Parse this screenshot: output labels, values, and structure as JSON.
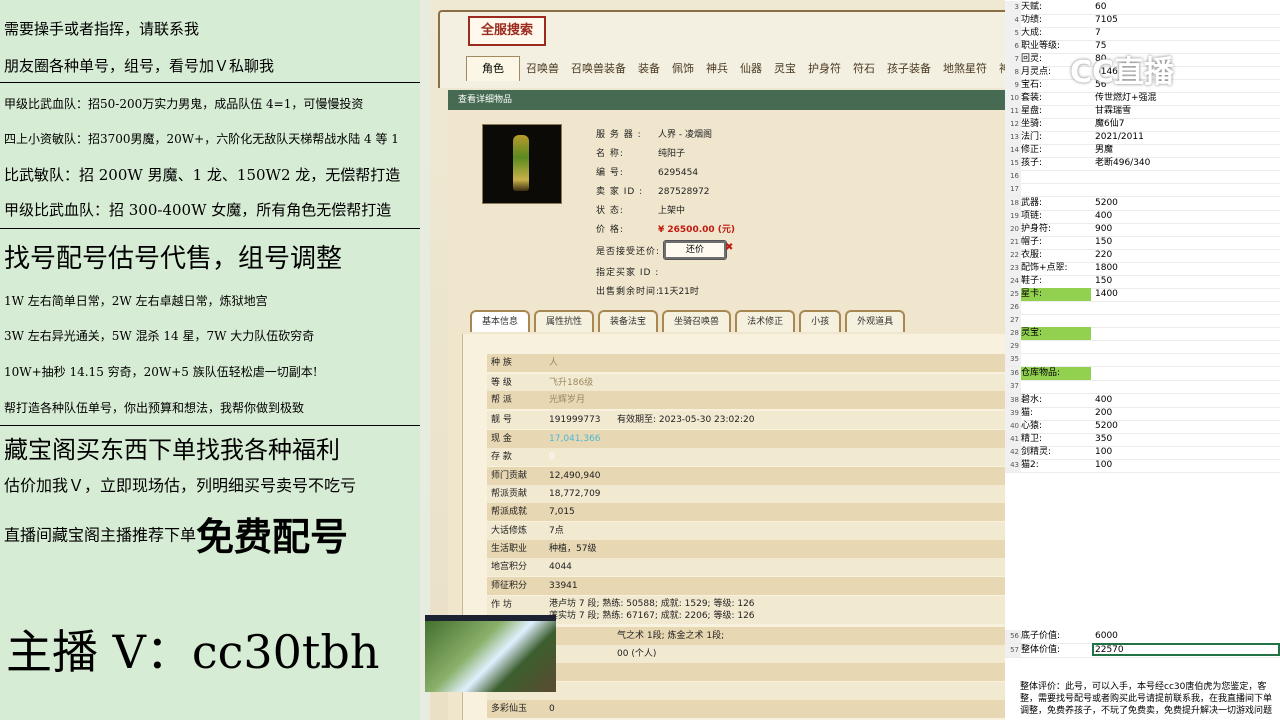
{
  "promo": {
    "line1": "需要操手或者指挥，请联系我",
    "line2": "朋友圈各种单号，组号，看号加Ｖ私聊我",
    "line3": "甲级比武血队：招50-200万实力男鬼，成品队伍 4=1，可慢慢投资",
    "line4": "四上小资敏队：招3700男魔，20W+，六阶化无敌队天梯帮战水陆 4 等 1",
    "line5": "比武敏队：招 200W 男魔、1 龙、150W2 龙，无偿帮打造",
    "line6": "甲级比武血队：招 300-400W 女魔，所有角色无偿帮打造",
    "line7": "找号配号估号代售，组号调整",
    "line8": "1W 左右简单日常，2W 左右卓越日常，炼狱地宫",
    "line9": "3W 左右异光通关，5W 混杀 14 星，7W 大力队伍砍穷奇",
    "line10": "10W+抽秒 14.15 穷奇，20W+5 族队伍轻松虐一切副本!",
    "line11": "帮打造各种队伍单号，你出预算和想法，我帮你做到极致",
    "line12": "藏宝阁买东西下单找我各种福利",
    "line13": "估价加我Ｖ，立即现场估，列明细买号卖号不吃亏",
    "line14a": "直播间藏宝阁主播推荐下单",
    "line14b": "免费配号",
    "streamer": "主播 V：cc30tbh"
  },
  "game": {
    "search_title": "全服搜索",
    "tabs": [
      "角色",
      "召唤兽",
      "召唤兽装备",
      "装备",
      "佩饰",
      "神兵",
      "仙器",
      "灵宝",
      "护身符",
      "符石",
      "孩子装备",
      "地煞星符",
      "神"
    ],
    "detail_bar": "查看详细物品",
    "info": {
      "server_k": "服 务 器 :",
      "server_v": "人界 - 凌烟阁",
      "name_k": "名        称:",
      "name_v": "纯阳子",
      "id_k": "编        号:",
      "id_v": "6295454",
      "seller_k": "卖 家 ID :",
      "seller_v": "287528972",
      "status_k": "状        态:",
      "status_v": "上架中",
      "price_k": "价        格:",
      "price_v": "¥ 26500.00 (元)",
      "haggle_k": "是否接受还价:",
      "haggle_btn": "还价",
      "buyer_k": "指定买家 ID :",
      "buyer_v": "",
      "remain_k": "出售剩余时间:",
      "remain_v": "11天21时"
    },
    "sections": [
      "基本信息",
      "属性抗性",
      "装备法宝",
      "坐骑召唤兽",
      "法术修正",
      "小孩",
      "外观道具"
    ],
    "rows": [
      {
        "k": "种    族",
        "v": "人"
      },
      {
        "k": "等    级",
        "v": "飞升186级"
      },
      {
        "k": "帮    派",
        "v": "光辉岁月"
      },
      {
        "k": "靓    号",
        "v": "191999773",
        "extra": "有效期至:  2023-05-30 23:02:20"
      },
      {
        "k": "现    金",
        "v": "17,041,366"
      },
      {
        "k": "存    款",
        "v": "0"
      },
      {
        "k": "师门贡献",
        "v": "12,490,940"
      },
      {
        "k": "帮派贡献",
        "v": "18,772,709"
      },
      {
        "k": "帮派成就",
        "v": "7,015"
      },
      {
        "k": "大话修炼",
        "v": "7点"
      },
      {
        "k": "生活职业",
        "v": "种植，57级"
      },
      {
        "k": "地宫积分",
        "v": "4044"
      },
      {
        "k": "师征积分",
        "v": "33941"
      },
      {
        "k": "作    坊",
        "v": "港卢坊 7 段; 熟练:  50588;  成就:  1529;  等级:  126",
        "v2": "莲实坊 7 段; 熟练:  67167;  成就:  2206;  等级:  126"
      },
      {
        "k": "",
        "v": "气之术 1段; 炼金之术 1段;"
      },
      {
        "k": "",
        "v": "00 (个人)"
      },
      {
        "k": "",
        "v": ""
      },
      {
        "k": "",
        "v": ""
      },
      {
        "k": "多彩仙玉",
        "v": "0"
      }
    ]
  },
  "sheet": {
    "logo": "CC直播",
    "rows": [
      {
        "n": "3",
        "k": "天赋:",
        "v": "60"
      },
      {
        "n": "4",
        "k": "功绩:",
        "v": "7105"
      },
      {
        "n": "5",
        "k": "大成:",
        "v": "7"
      },
      {
        "n": "6",
        "k": "职业等级:",
        "v": "75"
      },
      {
        "n": "7",
        "k": "回灵:",
        "v": "80"
      },
      {
        "n": "8",
        "k": "月灵点:",
        "v": "6146"
      },
      {
        "n": "9",
        "k": "宝石:",
        "v": "56"
      },
      {
        "n": "10",
        "k": "套装:",
        "v": "传世燃灯+强混"
      },
      {
        "n": "11",
        "k": "星盘:",
        "v": "甘霖瑞雪"
      },
      {
        "n": "12",
        "k": "坐骑:",
        "v": "魔6仙7"
      },
      {
        "n": "13",
        "k": "法门:",
        "v": "2021/2011"
      },
      {
        "n": "14",
        "k": "修正:",
        "v": "男魔"
      },
      {
        "n": "15",
        "k": "孩子:",
        "v": "老断496/340"
      },
      {
        "n": "16",
        "k": "",
        "v": ""
      },
      {
        "n": "17",
        "k": "",
        "v": ""
      },
      {
        "n": "18",
        "k": "武器:",
        "v": "5200"
      },
      {
        "n": "19",
        "k": "项链:",
        "v": "400"
      },
      {
        "n": "20",
        "k": "护身符:",
        "v": "900"
      },
      {
        "n": "21",
        "k": "帽子:",
        "v": "150"
      },
      {
        "n": "22",
        "k": "衣服:",
        "v": "220"
      },
      {
        "n": "23",
        "k": "配饰+点翠:",
        "v": "1800"
      },
      {
        "n": "24",
        "k": "鞋子:",
        "v": "150"
      },
      {
        "n": "25",
        "k": "星卡:",
        "v": "1400",
        "hl": true
      },
      {
        "n": "26",
        "k": "",
        "v": ""
      },
      {
        "n": "27",
        "k": "",
        "v": ""
      },
      {
        "n": "28",
        "k": "灵宝:",
        "v": "",
        "hl": true
      },
      {
        "n": "29",
        "k": "",
        "v": ""
      },
      {
        "n": "35",
        "k": "",
        "v": ""
      },
      {
        "n": "36",
        "k": "仓库物品:",
        "v": "",
        "hl": true
      },
      {
        "n": "37",
        "k": "",
        "v": ""
      },
      {
        "n": "38",
        "k": "碧水:",
        "v": "400"
      },
      {
        "n": "39",
        "k": "猫:",
        "v": "200"
      },
      {
        "n": "40",
        "k": "心猿:",
        "v": "5200"
      },
      {
        "n": "41",
        "k": "精卫:",
        "v": "350"
      },
      {
        "n": "42",
        "k": "剑精灵:",
        "v": "100"
      },
      {
        "n": "43",
        "k": "猫2:",
        "v": "100"
      }
    ],
    "bottom_rows": [
      {
        "n": "56",
        "k": "底子价值:",
        "v": "6000"
      },
      {
        "n": "57",
        "k": "整体价值:",
        "v": "22570"
      }
    ],
    "eval1": "整体评价：此号，可以入手，本号经cc30唐伯虎为您鉴定，客",
    "eval2": "整，需要找号配号或者购买此号请提前联系我，在我直播间下单",
    "eval3": "调整，免费养孩子，不玩了免费卖，免费提升解决一切游戏问题"
  }
}
